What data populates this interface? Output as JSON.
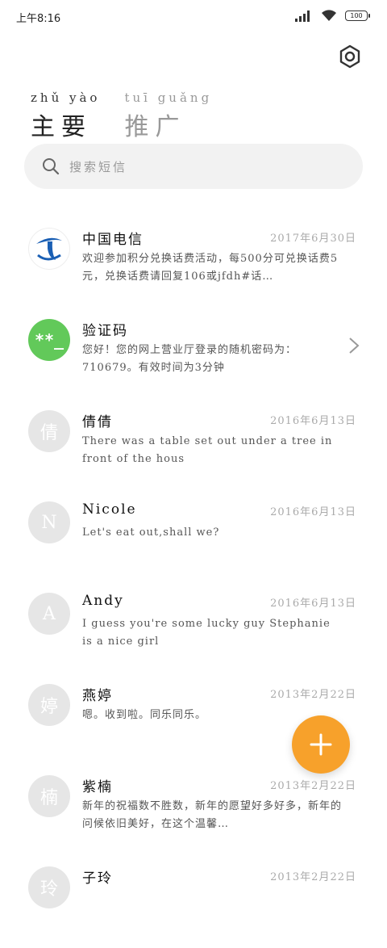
{
  "status": {
    "time": "上午8:16",
    "battery": "100"
  },
  "tabs": [
    {
      "pinyin": "zhǔ yào",
      "title": "主要"
    },
    {
      "pinyin": "tuī guǎng",
      "title": "推广"
    }
  ],
  "search": {
    "placeholder": "搜索短信"
  },
  "messages": [
    {
      "name": "中国电信",
      "date": "2017年6月30日",
      "preview": "欢迎参加积分兑换话费活动，每500分可兑换话费5元，兑换话费请回复106或jfdh#话…",
      "avatar": ""
    },
    {
      "name": "验证码",
      "date": "",
      "preview": "您好！您的网上营业厅登录的随机密码为：710679。有效时间为3分钟",
      "avatar": "**_"
    },
    {
      "name": "倩倩",
      "date": "2016年6月13日",
      "preview": "There was a table set out under a tree in front of the hous",
      "avatar": "倩"
    },
    {
      "name": "Nicole",
      "date": "2016年6月13日",
      "preview": "Let's eat out,shall we?",
      "avatar": "N"
    },
    {
      "name": "Andy",
      "date": "2016年6月13日",
      "preview": "I guess you're some lucky guy Stephanie is a nice girl",
      "avatar": "A"
    },
    {
      "name": "燕婷",
      "date": "2013年2月22日",
      "preview": "嗯。收到啦。同乐同乐。",
      "avatar": "婷"
    },
    {
      "name": "紫楠",
      "date": "2013年2月22日",
      "preview": "新年的祝福数不胜数，新年的愿望好多好多，新年的问候依旧美好，在这个温馨…",
      "avatar": "楠"
    },
    {
      "name": "子玲",
      "date": "2013年2月22日",
      "preview": "",
      "avatar": "玲"
    }
  ],
  "colors": {
    "accent": "#f7a12b",
    "verify": "#62c95a",
    "telecom": "#1a5fb4"
  }
}
